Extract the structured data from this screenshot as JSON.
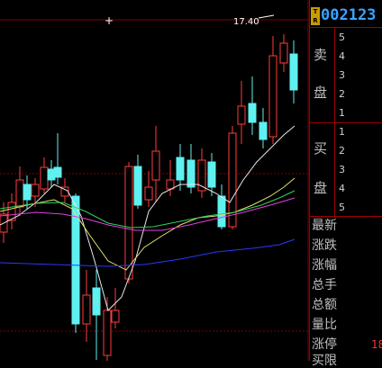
{
  "chart": {
    "high_label": "17.40",
    "crosshair_symbol": "+",
    "colors": {
      "up": "#ff3c3c",
      "down": "#5ff0f0",
      "ma_white": "#e8e8e8",
      "ma_yellow": "#e0e070",
      "ma_green": "#30d060",
      "ma_magenta": "#e040e0",
      "ma_blue": "#2838ff",
      "grid": "#800000"
    }
  },
  "panel": {
    "market_tag": "T R",
    "code": "002123",
    "sell_label_1": "卖",
    "sell_label_2": "盘",
    "buy_label_1": "买",
    "buy_label_2": "盘",
    "sell_levels": [
      "5",
      "4",
      "3",
      "2",
      "1"
    ],
    "buy_levels": [
      "1",
      "2",
      "3",
      "4",
      "5"
    ],
    "quote_labels": [
      "最新",
      "涨跌",
      "涨幅",
      "总手",
      "总额",
      "量比",
      "涨停",
      "买限"
    ],
    "limit_up_value": "18"
  }
}
